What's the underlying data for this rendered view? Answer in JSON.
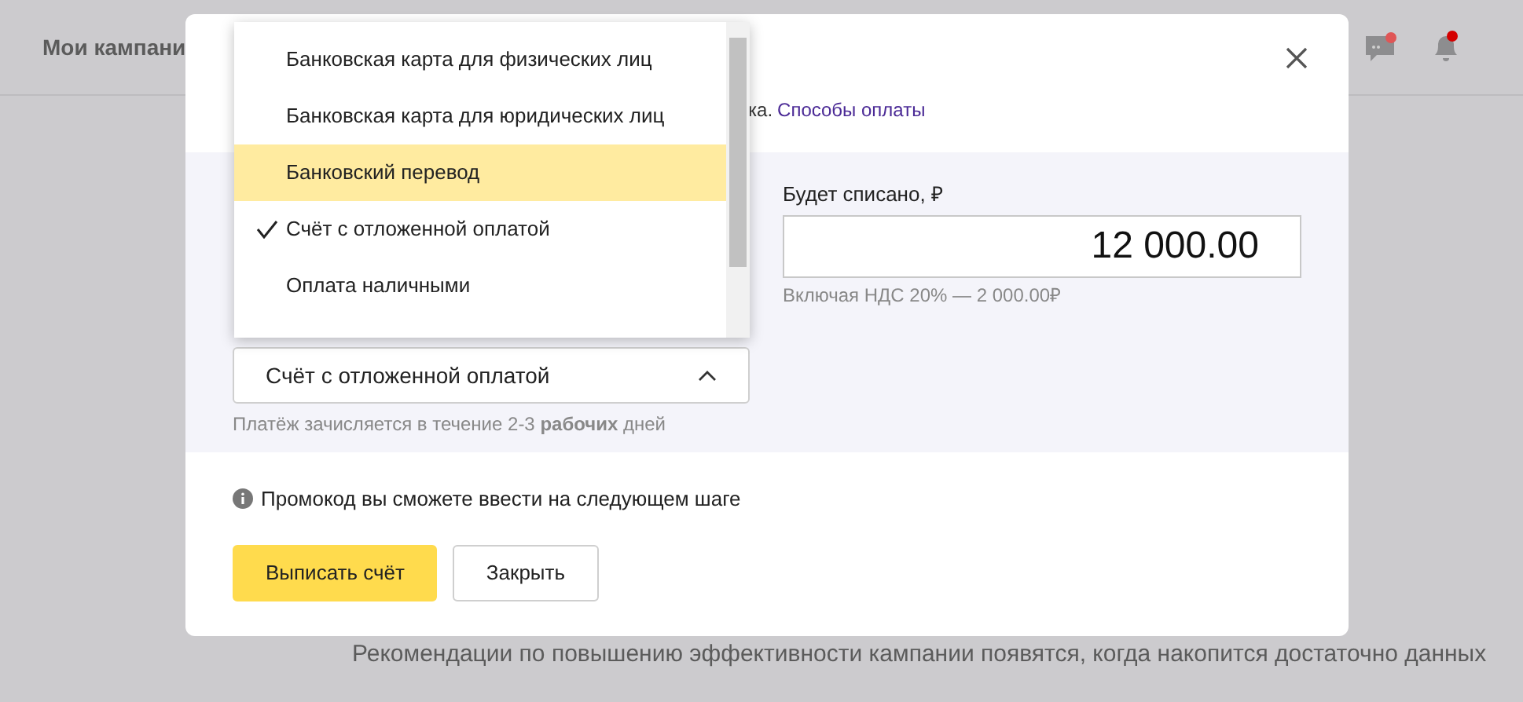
{
  "header": {
    "title": "Мои кампани"
  },
  "background_text": "Рекомендации по повышению эффективности кампании появятся, когда накопится достаточно данных",
  "dialog": {
    "intro_text": "ка.",
    "intro_link": "Способы оплаты",
    "amount": {
      "label": "Будет списано, ₽",
      "value": "12 000.00",
      "hint": "Включая НДС 20% — 2 000.00₽"
    },
    "payment_method": {
      "value": "Счёт с отложенной оплатой",
      "expanded": true,
      "hint": "Платёж зачисляется в течение 2-3 **рабочих** дней",
      "options": [
        {
          "label": "Банковская карта для физических лиц",
          "highlighted": false,
          "selected": false
        },
        {
          "label": "Банковская карта для юридических лиц",
          "highlighted": false,
          "selected": false
        },
        {
          "label": "Банковский перевод",
          "highlighted": true,
          "selected": false
        },
        {
          "label": "Счёт с отложенной оплатой",
          "highlighted": false,
          "selected": true
        },
        {
          "label": "Оплата наличными",
          "highlighted": false,
          "selected": false
        }
      ]
    },
    "promo_note": "Промокод вы сможете ввести на следующем шаге",
    "buttons": [
      {
        "label": "Выписать счёт",
        "kind": "primary"
      },
      {
        "label": "Закрыть",
        "kind": "secondary"
      }
    ]
  }
}
